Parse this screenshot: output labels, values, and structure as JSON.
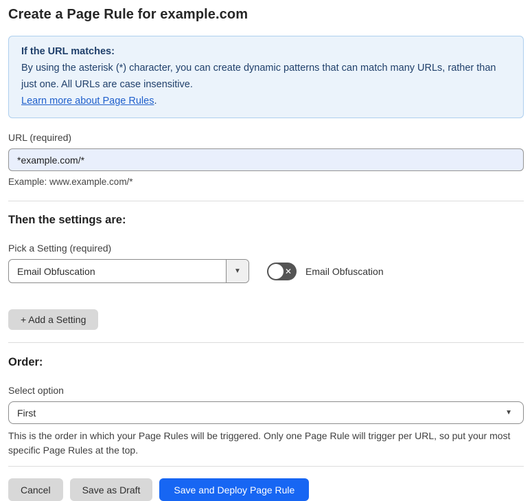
{
  "page": {
    "title": "Create a Page Rule for example.com"
  },
  "info_box": {
    "heading": "If the URL matches:",
    "body": "By using the asterisk (*) character, you can create dynamic patterns that can match many URLs, rather than just one. All URLs are case insensitive.",
    "link_label": "Learn more about Page Rules",
    "link_suffix": "."
  },
  "url_field": {
    "label": "URL (required)",
    "value": "*example.com/*",
    "example": "Example: www.example.com/*"
  },
  "settings_section": {
    "heading": "Then the settings are:",
    "picker_label": "Pick a Setting (required)",
    "picker_value": "Email Obfuscation",
    "picker_arrow": "▼",
    "toggle_state": "off",
    "toggle_glyph": "✕",
    "toggle_label": "Email Obfuscation",
    "add_setting_label": "+ Add a Setting"
  },
  "order_section": {
    "heading": "Order:",
    "select_label": "Select option",
    "select_value": "First",
    "select_chevron": "▼",
    "help_text": "This is the order in which your Page Rules will be triggered. Only one Page Rule will trigger per URL, so put your most specific Page Rules at the top."
  },
  "footer": {
    "cancel_label": "Cancel",
    "save_draft_label": "Save as Draft",
    "save_deploy_label": "Save and Deploy Page Rule"
  },
  "colors": {
    "accent_blue": "#1766f3",
    "info_bg": "#ebf3fb",
    "info_border": "#aecfee",
    "info_text": "#20406b",
    "link_blue": "#2060cc",
    "input_bg": "#e9effc",
    "toggle_track": "#545454",
    "button_gray": "#d8d8d8"
  }
}
